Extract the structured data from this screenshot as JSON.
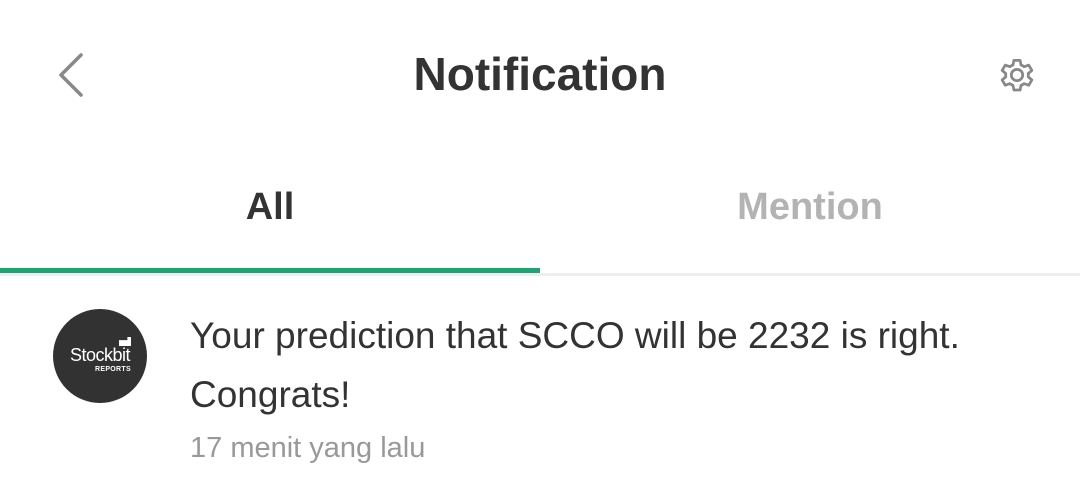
{
  "header": {
    "title": "Notification",
    "back_icon": "chevron-left-icon",
    "settings_icon": "gear-icon"
  },
  "tabs": [
    {
      "label": "All",
      "active": true
    },
    {
      "label": "Mention",
      "active": false
    }
  ],
  "colors": {
    "accent": "#1ea672",
    "text_primary": "#333333",
    "text_inactive": "#b3b3b3",
    "text_muted": "#999999",
    "avatar_bg": "#323232"
  },
  "notifications": [
    {
      "avatar": {
        "brand": "Stockbit",
        "sub": "REPORTS"
      },
      "message": "Your prediction that SCCO will be 2232 is right. Congrats!",
      "time": "17 menit yang lalu"
    }
  ]
}
